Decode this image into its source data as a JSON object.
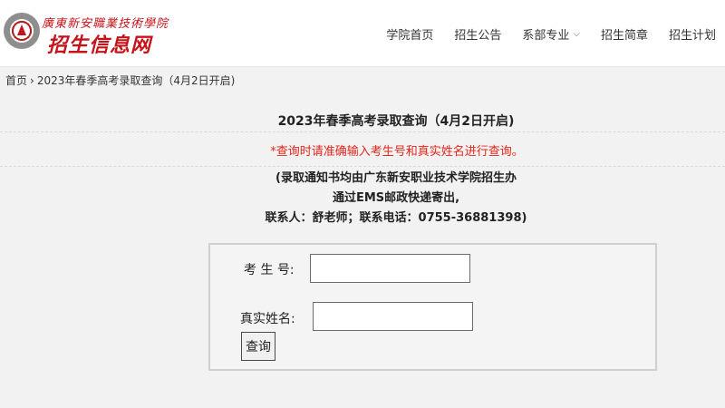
{
  "header": {
    "school_name": "廣東新安職業技術學院",
    "site_title": "招生信息网",
    "nav": [
      {
        "label": "学院首页"
      },
      {
        "label": "招生公告"
      },
      {
        "label": "系部专业",
        "has_dropdown": true
      },
      {
        "label": "招生简章"
      },
      {
        "label": "招生计划"
      }
    ]
  },
  "breadcrumb": {
    "home": "首页",
    "separator": "›",
    "current": "2023年春季高考录取查询（4月2日开启)"
  },
  "main": {
    "title": "2023年春季高考录取查询（4月2日开启)",
    "warning": "*查询时请准确输入考生号和真实姓名进行查询。",
    "notice_lines": [
      "(录取通知书均由广东新安职业技术学院招生办",
      "通过EMS邮政快递寄出,",
      "联系人：舒老师；联系电话：0755-36881398)"
    ]
  },
  "form": {
    "exam_no_label": "考 生 号:",
    "exam_no_value": "",
    "name_label": "真实姓名:",
    "name_value": "",
    "submit_label": "查询"
  },
  "colors": {
    "brand_red": "#c4141a",
    "warning_red": "#e3261b",
    "background": "#f2f2f2"
  },
  "icons": {
    "logo": "school-emblem-icon",
    "dropdown": "chevron-down-icon"
  }
}
